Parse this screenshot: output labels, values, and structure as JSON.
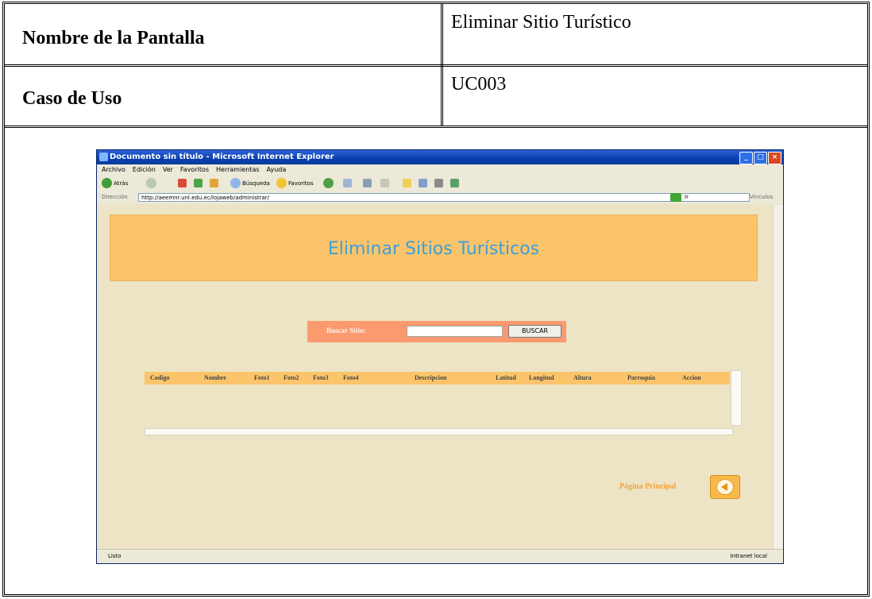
{
  "doc": {
    "row1_label": "Nombre de la Pantalla",
    "row1_value": "Eliminar Sitio Turístico",
    "row2_label": "Caso de Uso",
    "row2_value": "UC003"
  },
  "ie": {
    "window_title": "Documento sin título - Microsoft Internet Explorer",
    "menu": [
      "Archivo",
      "Edición",
      "Ver",
      "Favoritos",
      "Herramientas",
      "Ayuda"
    ],
    "toolbar": {
      "back": "Atrás",
      "search": "Búsqueda",
      "favorites": "Favoritos"
    },
    "address_label": "Dirección",
    "address": "http://aeemnr.unl.edu.ec/lojaweb/administrar/",
    "go": "Ir",
    "links": "Vínculos",
    "status_left": "Listo",
    "status_right": "Intranet local"
  },
  "page": {
    "banner_title": "Eliminar Sitios Turísticos",
    "search_label": "Buscar Sitio:",
    "search_value": "",
    "search_button": "BUSCAR",
    "columns": [
      "Codigo",
      "Nombre",
      "Foto1",
      "Foto2",
      "Foto3",
      "Foto4",
      "Descripcion",
      "Latitud",
      "Longitud",
      "Altura",
      "Parroquia",
      "Accion"
    ],
    "home_link": "Página Principal"
  },
  "colors": {
    "banner": "#fcc46a",
    "banner_text": "#3b9fd8",
    "search_panel": "#fb9a6e",
    "page_bg": "#ece4c5",
    "title_bar": "#0a3fb0"
  }
}
